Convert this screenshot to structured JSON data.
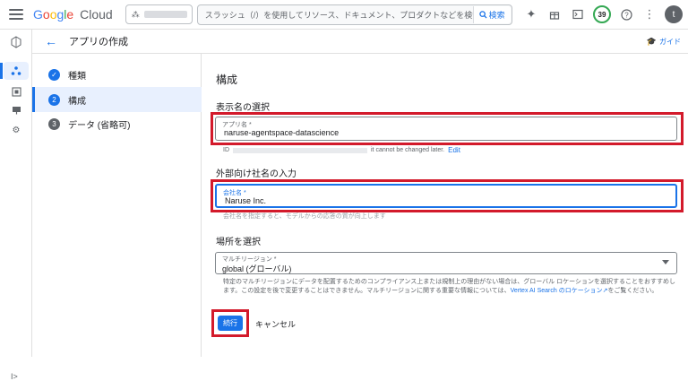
{
  "topbar": {
    "logo_letters": [
      "G",
      "o",
      "o",
      "g",
      "l",
      "e"
    ],
    "logo_suffix": "Cloud",
    "search_placeholder": "スラッシュ（/）を使用してリソース、ドキュメント、プロダクトなどを検索",
    "search_button": "検索",
    "notification_count": "39",
    "avatar_initial": "t"
  },
  "header": {
    "title": "アプリの作成",
    "guide_label": "ガイド"
  },
  "stepper": {
    "steps": [
      {
        "number": "✓",
        "label": "種類",
        "state": "done"
      },
      {
        "number": "2",
        "label": "構成",
        "state": "active"
      },
      {
        "number": "3",
        "label": "データ (省略可)",
        "state": "pending"
      }
    ]
  },
  "form": {
    "section_title": "構成",
    "display_name_heading": "表示名の選択",
    "app_name_label": "アプリ名 *",
    "app_name_value": "naruse-agentspace-datascience",
    "id_prefix": "ID",
    "id_note": "it cannot be changed later.",
    "id_edit": "Edit",
    "company_heading": "外部向け社名の入力",
    "company_label": "会社名 *",
    "company_value": "Naruse Inc.",
    "company_hint": "会社名を指定すると、モデルからの応答の質が向上します",
    "location_heading": "場所を選択",
    "location_label": "マルチリージョン *",
    "location_value": "global (グローバル)",
    "location_desc": "特定のマルチリージョンにデータを配置するためのコンプライアンス上または規制上の理由がない場合は、グローバル ロケーションを選択することをおすすめします。この設定を後で変更することはできません。マルチリージョンに関する重要な情報については、",
    "location_link": "Vertex AI Search のロケーション",
    "location_desc_end": "をご覧ください。",
    "continue_button": "続行",
    "cancel_button": "キャンセル"
  },
  "colors": {
    "accent": "#1a73e8",
    "highlight": "#d31a2b"
  }
}
